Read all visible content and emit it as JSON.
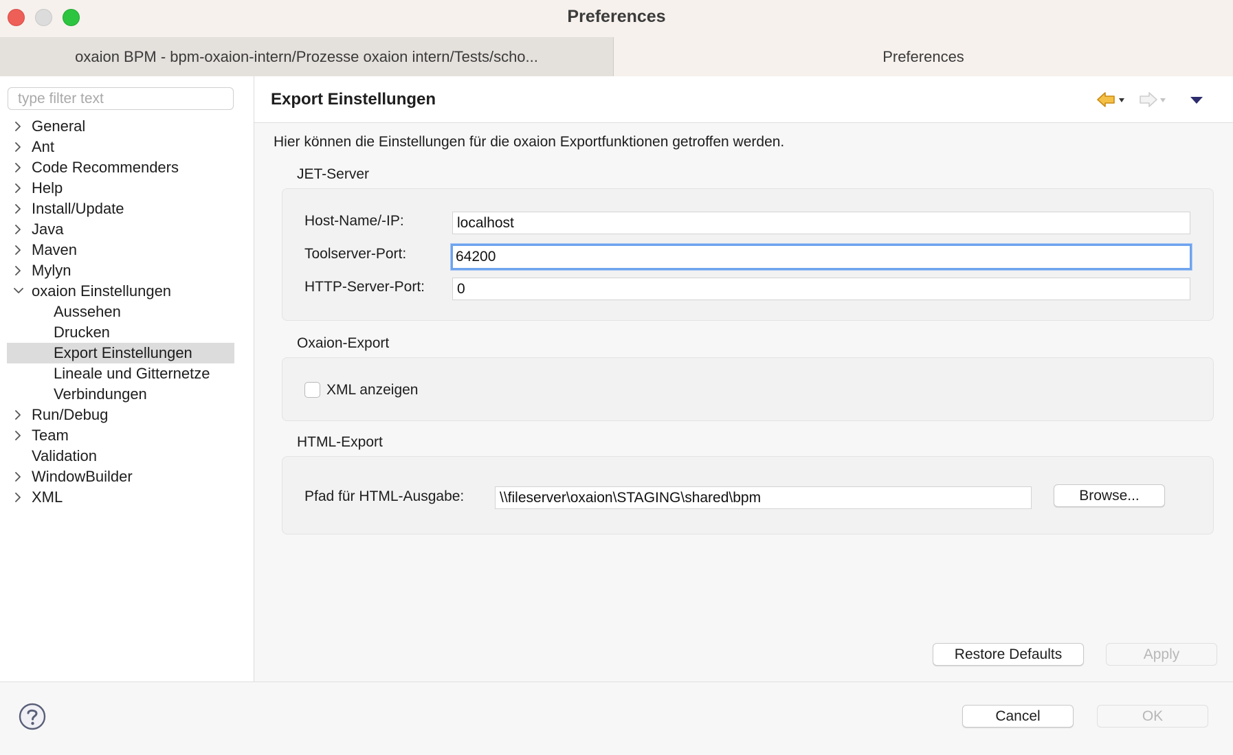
{
  "window": {
    "title": "Preferences"
  },
  "tabs": [
    {
      "label": "oxaion BPM - bpm-oxaion-intern/Prozesse oxaion intern/Tests/scho..."
    },
    {
      "label": "Preferences"
    }
  ],
  "sidebar": {
    "filter_placeholder": "type filter text",
    "items": [
      {
        "label": "General",
        "expandable": true
      },
      {
        "label": "Ant",
        "expandable": true
      },
      {
        "label": "Code Recommenders",
        "expandable": true
      },
      {
        "label": "Help",
        "expandable": true
      },
      {
        "label": "Install/Update",
        "expandable": true
      },
      {
        "label": "Java",
        "expandable": true
      },
      {
        "label": "Maven",
        "expandable": true
      },
      {
        "label": "Mylyn",
        "expandable": true
      },
      {
        "label": "oxaion Einstellungen",
        "expandable": true,
        "expanded": true,
        "children": [
          {
            "label": "Aussehen"
          },
          {
            "label": "Drucken"
          },
          {
            "label": "Export Einstellungen",
            "selected": true
          },
          {
            "label": "Lineale und Gitternetze"
          },
          {
            "label": "Verbindungen"
          }
        ]
      },
      {
        "label": "Run/Debug",
        "expandable": true
      },
      {
        "label": "Team",
        "expandable": true
      },
      {
        "label": "Validation",
        "expandable": false
      },
      {
        "label": "WindowBuilder",
        "expandable": true
      },
      {
        "label": "XML",
        "expandable": true
      }
    ]
  },
  "page": {
    "title": "Export Einstellungen",
    "description": "Hier können die Einstellungen für die oxaion Exportfunktionen getroffen werden.",
    "jet_server": {
      "label": "JET-Server",
      "host_label": "Host-Name/-IP:",
      "host_value": "localhost",
      "toolserver_label": "Toolserver-Port:",
      "toolserver_value": "64200",
      "http_label": "HTTP-Server-Port:",
      "http_value": "0"
    },
    "oxaion_export": {
      "label": "Oxaion-Export",
      "xml_label": "XML anzeigen",
      "xml_checked": false
    },
    "html_export": {
      "label": "HTML-Export",
      "path_label": "Pfad für HTML-Ausgabe:",
      "path_value": "\\\\fileserver\\oxaion\\STAGING\\shared\\bpm",
      "browse_label": "Browse..."
    },
    "restore_defaults_label": "Restore Defaults",
    "apply_label": "Apply"
  },
  "footer": {
    "cancel_label": "Cancel",
    "ok_label": "OK"
  },
  "icons": {
    "back": "back-arrow-icon",
    "forward": "forward-arrow-icon",
    "menu": "view-menu-icon",
    "help": "help-icon"
  },
  "colors": {
    "focus": "#6ea3ee",
    "selection": "#dcdcdc",
    "back_arrow": "#e9a51f"
  }
}
